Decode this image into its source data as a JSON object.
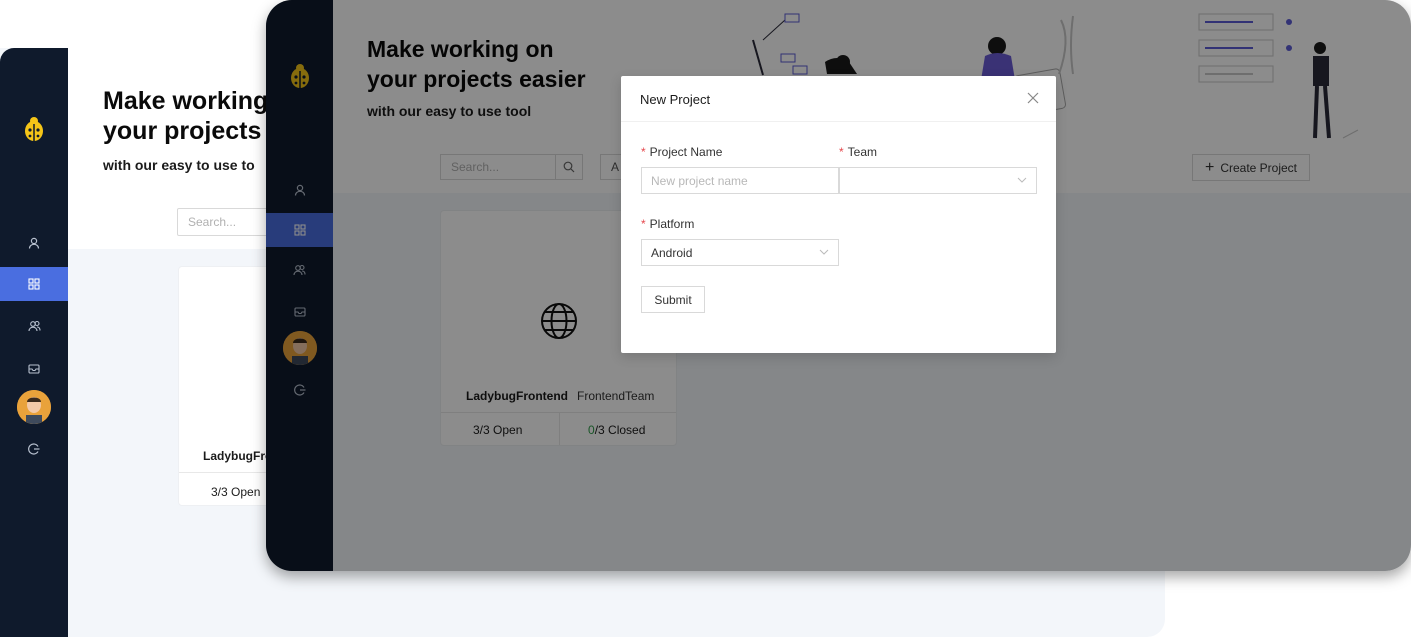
{
  "back_window": {
    "hero_title_line1": "Make working",
    "hero_title_line2": "your projects",
    "hero_subtitle": "with our easy to use to",
    "search_placeholder": "Search...",
    "card": {
      "name": "LadybugFro",
      "open_count": "3/3",
      "open_label": "Open"
    }
  },
  "front_window": {
    "hero_title_line1": "Make working on",
    "hero_title_line2": "your projects easier",
    "hero_subtitle": "with our easy to use tool",
    "search_placeholder": "Search...",
    "filter_value": "A",
    "create_button": "Create Project",
    "project_card": {
      "name": "LadybugFrontend",
      "team": "FrontendTeam",
      "open_count": "3/3",
      "open_label": "Open",
      "closed_count": "0",
      "closed_total": "/3",
      "closed_label": "Closed"
    }
  },
  "sidebar": {
    "icons": [
      "user-icon",
      "projects-grid-icon",
      "team-icon",
      "inbox-icon",
      "logout-icon"
    ],
    "active_item": "projects-grid-icon"
  },
  "modal": {
    "title": "New Project",
    "project_name_label": "Project Name",
    "project_name_placeholder": "New project name",
    "team_label": "Team",
    "team_value": "",
    "platform_label": "Platform",
    "platform_value": "Android",
    "submit_label": "Submit",
    "required_mark": "*"
  },
  "colors": {
    "sidebar_bg": "#0f1a2c",
    "active_nav": "#4a6ee0",
    "required": "#e5484d",
    "closed_count": "#2f9c4a",
    "logo_yellow": "#f5c518"
  }
}
